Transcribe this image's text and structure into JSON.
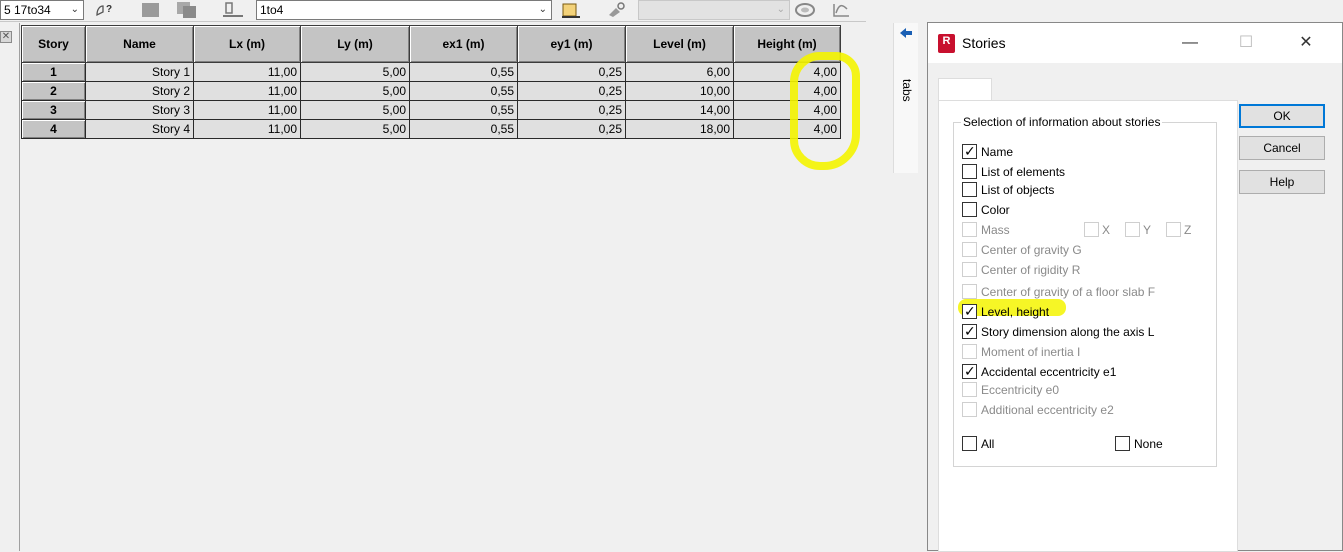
{
  "toolbar": {
    "case_combo": "5 17to34",
    "stories_combo": "1to4",
    "icons": [
      "help-pointer-icon",
      "grid-icon",
      "copy-icon",
      "structure-icon",
      "script-icon",
      "tools-icon",
      "disk-icon",
      "graph-icon"
    ]
  },
  "table": {
    "headers": [
      "Story",
      "Name",
      "Lx (m)",
      "Ly (m)",
      "ex1 (m)",
      "ey1 (m)",
      "Level (m)",
      "Height (m)"
    ],
    "rows": [
      [
        "1",
        "Story 1",
        "11,00",
        "5,00",
        "0,55",
        "0,25",
        "6,00",
        "4,00"
      ],
      [
        "2",
        "Story 2",
        "11,00",
        "5,00",
        "0,55",
        "0,25",
        "10,00",
        "4,00"
      ],
      [
        "3",
        "Story 3",
        "11,00",
        "5,00",
        "0,55",
        "0,25",
        "14,00",
        "4,00"
      ],
      [
        "4",
        "Story 4",
        "11,00",
        "5,00",
        "0,55",
        "0,25",
        "18,00",
        "4,00"
      ]
    ]
  },
  "side_tabs": {
    "label": "tabs"
  },
  "dialog": {
    "logo": "R",
    "title": "Stories",
    "group_title": "Selection of information about stories",
    "options": [
      {
        "label": "Name",
        "checked": true,
        "enabled": true
      },
      {
        "label": "List of elements",
        "checked": false,
        "enabled": true
      },
      {
        "label": "List of objects",
        "checked": false,
        "enabled": true
      },
      {
        "label": "Color",
        "checked": false,
        "enabled": true
      },
      {
        "label": "Mass",
        "checked": false,
        "enabled": false
      },
      {
        "label": "Center of gravity G",
        "checked": false,
        "enabled": false
      },
      {
        "label": "Center of rigidity R",
        "checked": false,
        "enabled": false
      },
      {
        "label": "Center of gravity of a floor slab F",
        "checked": false,
        "enabled": false
      },
      {
        "label": "Level, height",
        "checked": true,
        "enabled": true
      },
      {
        "label": "Story dimension along the axis L",
        "checked": true,
        "enabled": true
      },
      {
        "label": "Moment of inertia I",
        "checked": false,
        "enabled": false
      },
      {
        "label": "Accidental eccentricity e1",
        "checked": true,
        "enabled": true
      },
      {
        "label": "Eccentricity e0",
        "checked": false,
        "enabled": false
      },
      {
        "label": "Additional eccentricity e2",
        "checked": false,
        "enabled": false
      }
    ],
    "mass_axes": [
      "X",
      "Y",
      "Z"
    ],
    "all_label": "All",
    "none_label": "None",
    "buttons": {
      "ok": "OK",
      "cancel": "Cancel",
      "help": "Help"
    }
  },
  "colors": {
    "highlight": "#f4f400",
    "accent": "#0078d7",
    "logo": "#c8102e"
  }
}
